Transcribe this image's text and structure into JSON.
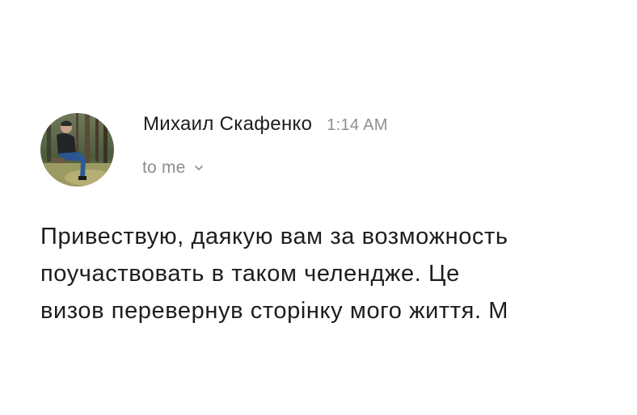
{
  "email": {
    "sender_name": "Михаил Скафенко",
    "time": "1:14 AM",
    "recipients": "to me",
    "avatar_icon": "person-photo-avatar",
    "chevron_icon": "chevron-down-icon",
    "body_lines": [
      "Привествую, даякую вам за возможность",
      "поучаствовать в таком челендже. Це",
      "визов перевернув сторінку мого життя. М"
    ]
  },
  "colors": {
    "text_primary": "#1d1d1f",
    "text_secondary": "#8e8e93",
    "background": "#ffffff"
  }
}
